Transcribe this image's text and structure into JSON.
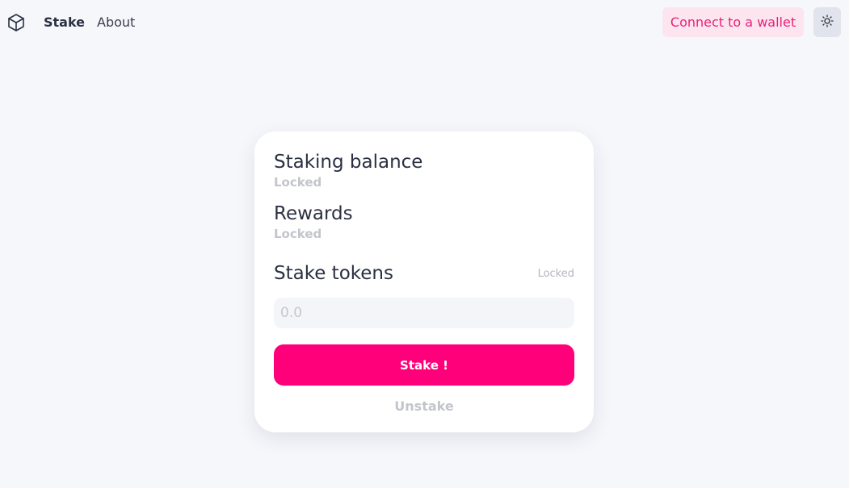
{
  "nav": {
    "logo_icon": "cube-icon",
    "links": [
      "Stake",
      "About"
    ],
    "connect_label": "Connect to a wallet",
    "theme_icon": "sun-icon"
  },
  "card": {
    "staking_balance_title": "Staking balance",
    "staking_balance_value": "Locked",
    "rewards_title": "Rewards",
    "rewards_value": "Locked",
    "stake_tokens_title": "Stake tokens",
    "stake_tokens_status": "Locked",
    "amount_placeholder": "0.0",
    "stake_button_label": "Stake !",
    "unstake_button_label": "Unstake"
  },
  "colors": {
    "accent": "#ff007a",
    "accent_soft": "#fde5ef",
    "background": "#f6f7fb"
  }
}
